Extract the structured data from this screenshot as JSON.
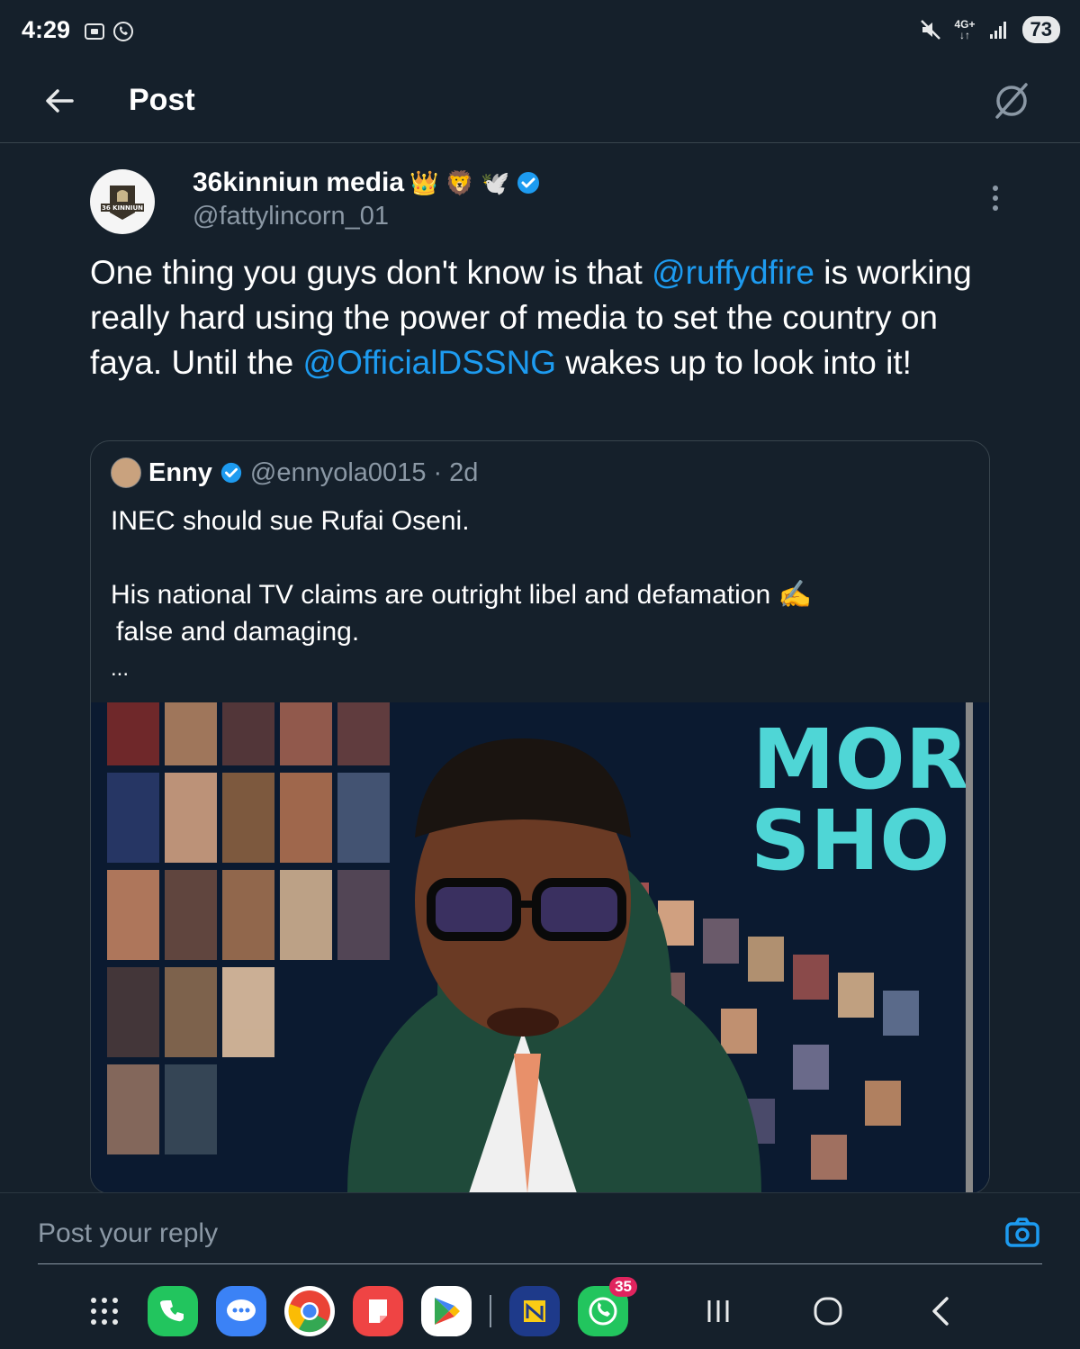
{
  "status_bar": {
    "time": "4:29",
    "network": "4G+",
    "battery": "73",
    "icons": [
      "screenshot-icon",
      "whatsapp-icon",
      "mute-icon",
      "signal-icon"
    ]
  },
  "header": {
    "title": "Post",
    "back_icon": "arrow-left-icon",
    "grok_icon": "grok-icon"
  },
  "tweet": {
    "author_name": "36kinniun media",
    "author_emojis": "👑 🦁 🕊️",
    "author_handle": "@fattylincorn_01",
    "avatar_text": "36 KINNIUN",
    "text_parts": {
      "p1": "One thing you guys don't know is that ",
      "mention1": "@ruffydfire",
      "p2": " is working really hard using the power of media to set the country on faya. Until the ",
      "mention2": "@OfficialDSSNG",
      "p3": " wakes up to look into it!"
    },
    "quote": {
      "name": "Enny",
      "handle": "@ennyola0015",
      "age": "· 2d",
      "line1": "INEC should sue Rufai Oseni.",
      "line2": "His national TV claims are outright libel and defamation ✍️",
      "line3": "false and damaging.",
      "ellipsis": "...",
      "media_overlay_1": "MOR",
      "media_overlay_2": "SHO"
    }
  },
  "reply": {
    "placeholder": "Post your reply"
  },
  "nav": {
    "apps": [
      "app-drawer",
      "phone",
      "messages",
      "chrome",
      "notes",
      "play-store",
      "ng-app",
      "whatsapp"
    ],
    "whatsapp_badge": "35"
  },
  "colors": {
    "background": "#15202b",
    "accent": "#1d9bf0",
    "text": "#e7e9ea",
    "muted": "#8b98a5",
    "border": "#38444d"
  }
}
